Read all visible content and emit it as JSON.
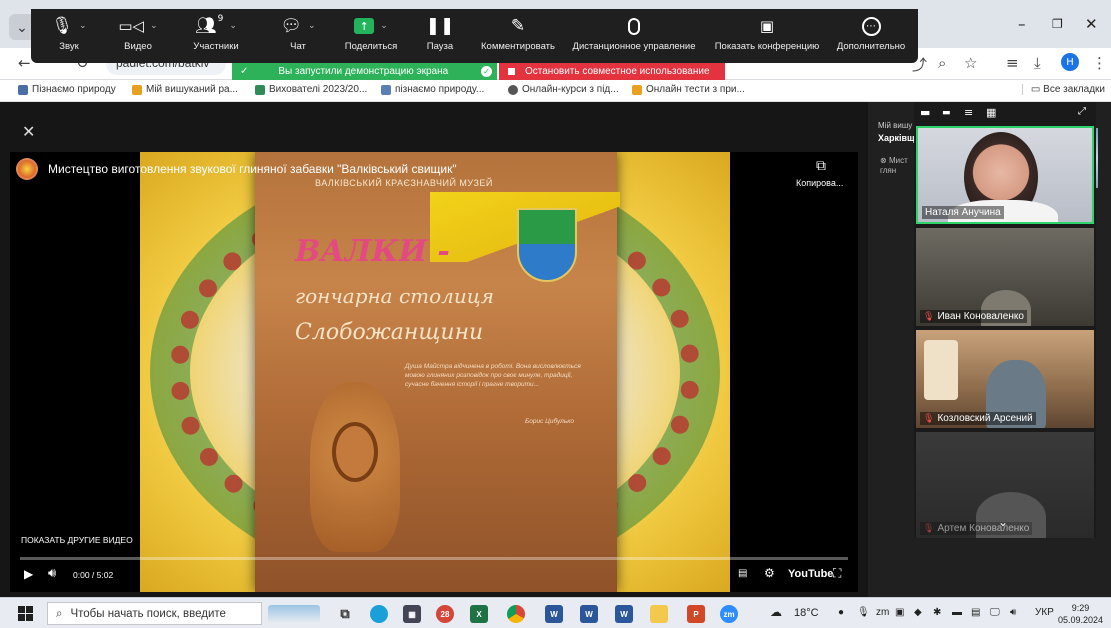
{
  "zoom_toolbar": {
    "items": [
      {
        "label": "Звук",
        "icon": "microphone-icon"
      },
      {
        "label": "Видео",
        "icon": "camera-icon"
      },
      {
        "label": "Участники",
        "icon": "participants-icon",
        "count": "9"
      },
      {
        "label": "Чат",
        "icon": "chat-icon"
      },
      {
        "label": "Поделиться",
        "icon": "share-icon"
      },
      {
        "label": "Пауза",
        "icon": "pause-icon"
      },
      {
        "label": "Комментировать",
        "icon": "pen-icon"
      },
      {
        "label": "Дистанционное управление",
        "icon": "mouse-icon"
      },
      {
        "label": "Показать конференцию",
        "icon": "meeting-icon"
      },
      {
        "label": "Дополнительно",
        "icon": "more-icon"
      }
    ]
  },
  "share_banner": {
    "status": "Вы запустили демонстрацию экрана",
    "stop": "Остановить совместное использование"
  },
  "browser": {
    "address": "padlet.com/batkiv",
    "all_bookmarks": "Все закладки",
    "bookmarks": [
      {
        "label": "Пізнаємо природу",
        "color": "#4a6fa5"
      },
      {
        "label": "Мій вишуканий ра...",
        "color": "#e8a020"
      },
      {
        "label": "Вихователі 2023/20...",
        "color": "#2e8b57"
      },
      {
        "label": "пізнаємо природу...",
        "color": "#5b7fb5"
      },
      {
        "label": "Онлайн-курси з під...",
        "color": "#555555"
      },
      {
        "label": "Онлайн тести з при...",
        "color": "#e8a020"
      }
    ]
  },
  "video": {
    "title": "Мистецтво виготовлення звукової глиняної забавки \"Валківський свищик\"",
    "copy_label": "Копирова...",
    "more_videos": "ПОКАЗАТЬ ДРУГИЕ ВИДЕО",
    "time": "0:00 / 5:02",
    "youtube": "YouTube",
    "progress": 0,
    "poster": {
      "museum": "ВАЛКІВСЬКИЙ КРАЄЗНАВЧИЙ МУЗЕЙ",
      "title1": "ВАЛКИ -",
      "title2": "гончарна столиця",
      "title3": "Слобожанщини",
      "quote": "Душа Майстра відчинена в роботі. Вона висловлюється мовою глиняних розповідок про своє минуле, традиції, сучасне бачення історії і прагне творити...",
      "author": "Борис Цибулько"
    }
  },
  "side_panel": {
    "line1": "Мій вишу",
    "line2": "Харківщ",
    "item": "Мист\nглян"
  },
  "gallery": {
    "participants": [
      {
        "name": "Наталя Анучина",
        "muted": false
      },
      {
        "name": "Иван Коноваленко",
        "muted": true
      },
      {
        "name": "Козловский Арсений",
        "muted": true
      },
      {
        "name": "Артем Коноваленко",
        "muted": true
      }
    ]
  },
  "taskbar": {
    "search_placeholder": "Чтобы начать поиск, введите",
    "temperature": "18°C",
    "language": "УКР",
    "time": "9:29",
    "date": "05.09.2024"
  }
}
